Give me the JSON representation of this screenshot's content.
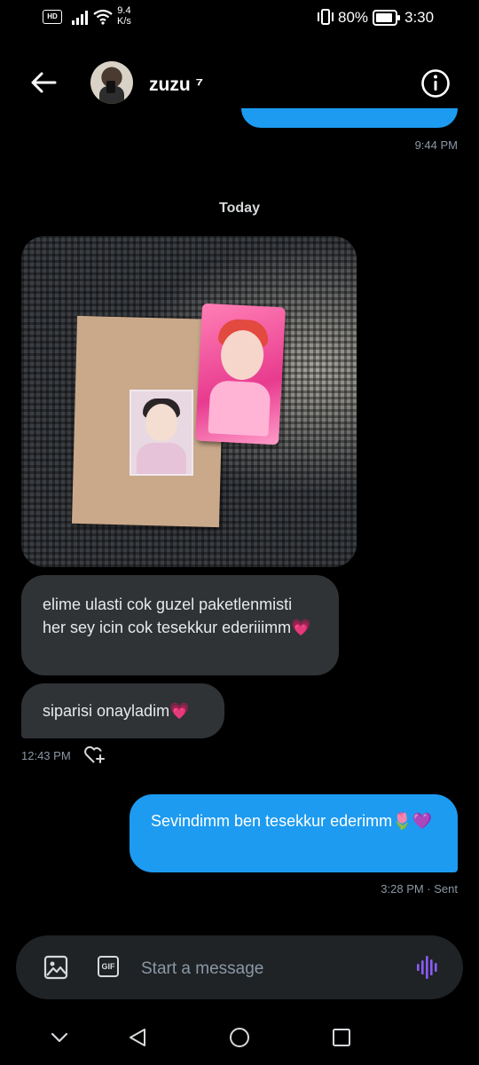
{
  "status_bar": {
    "network_badge": "HD",
    "speed_value": "9.4",
    "speed_unit": "K/s",
    "battery_pct": "80%",
    "time": "3:30"
  },
  "header": {
    "username": "zuzu",
    "username_suffix": "⁷"
  },
  "messages": {
    "prev_time": "9:44 PM",
    "day_divider": "Today",
    "incoming": [
      {
        "text": "elime ulasti cok guzel paketlenmisti her sey icin cok tesekkur ederiiimm💗"
      },
      {
        "text": "siparisi onayladim💗"
      }
    ],
    "incoming_time": "12:43 PM",
    "outgoing": {
      "text": "Sevindimm ben tesekkur ederimm🌷💜"
    },
    "outgoing_status": "3:28 PM · Sent"
  },
  "composer": {
    "gif_label": "GIF",
    "placeholder": "Start a message"
  },
  "colors": {
    "accent": "#1d9bf0",
    "incoming_bubble": "#2f3336",
    "voice": "#8b5cf6"
  }
}
